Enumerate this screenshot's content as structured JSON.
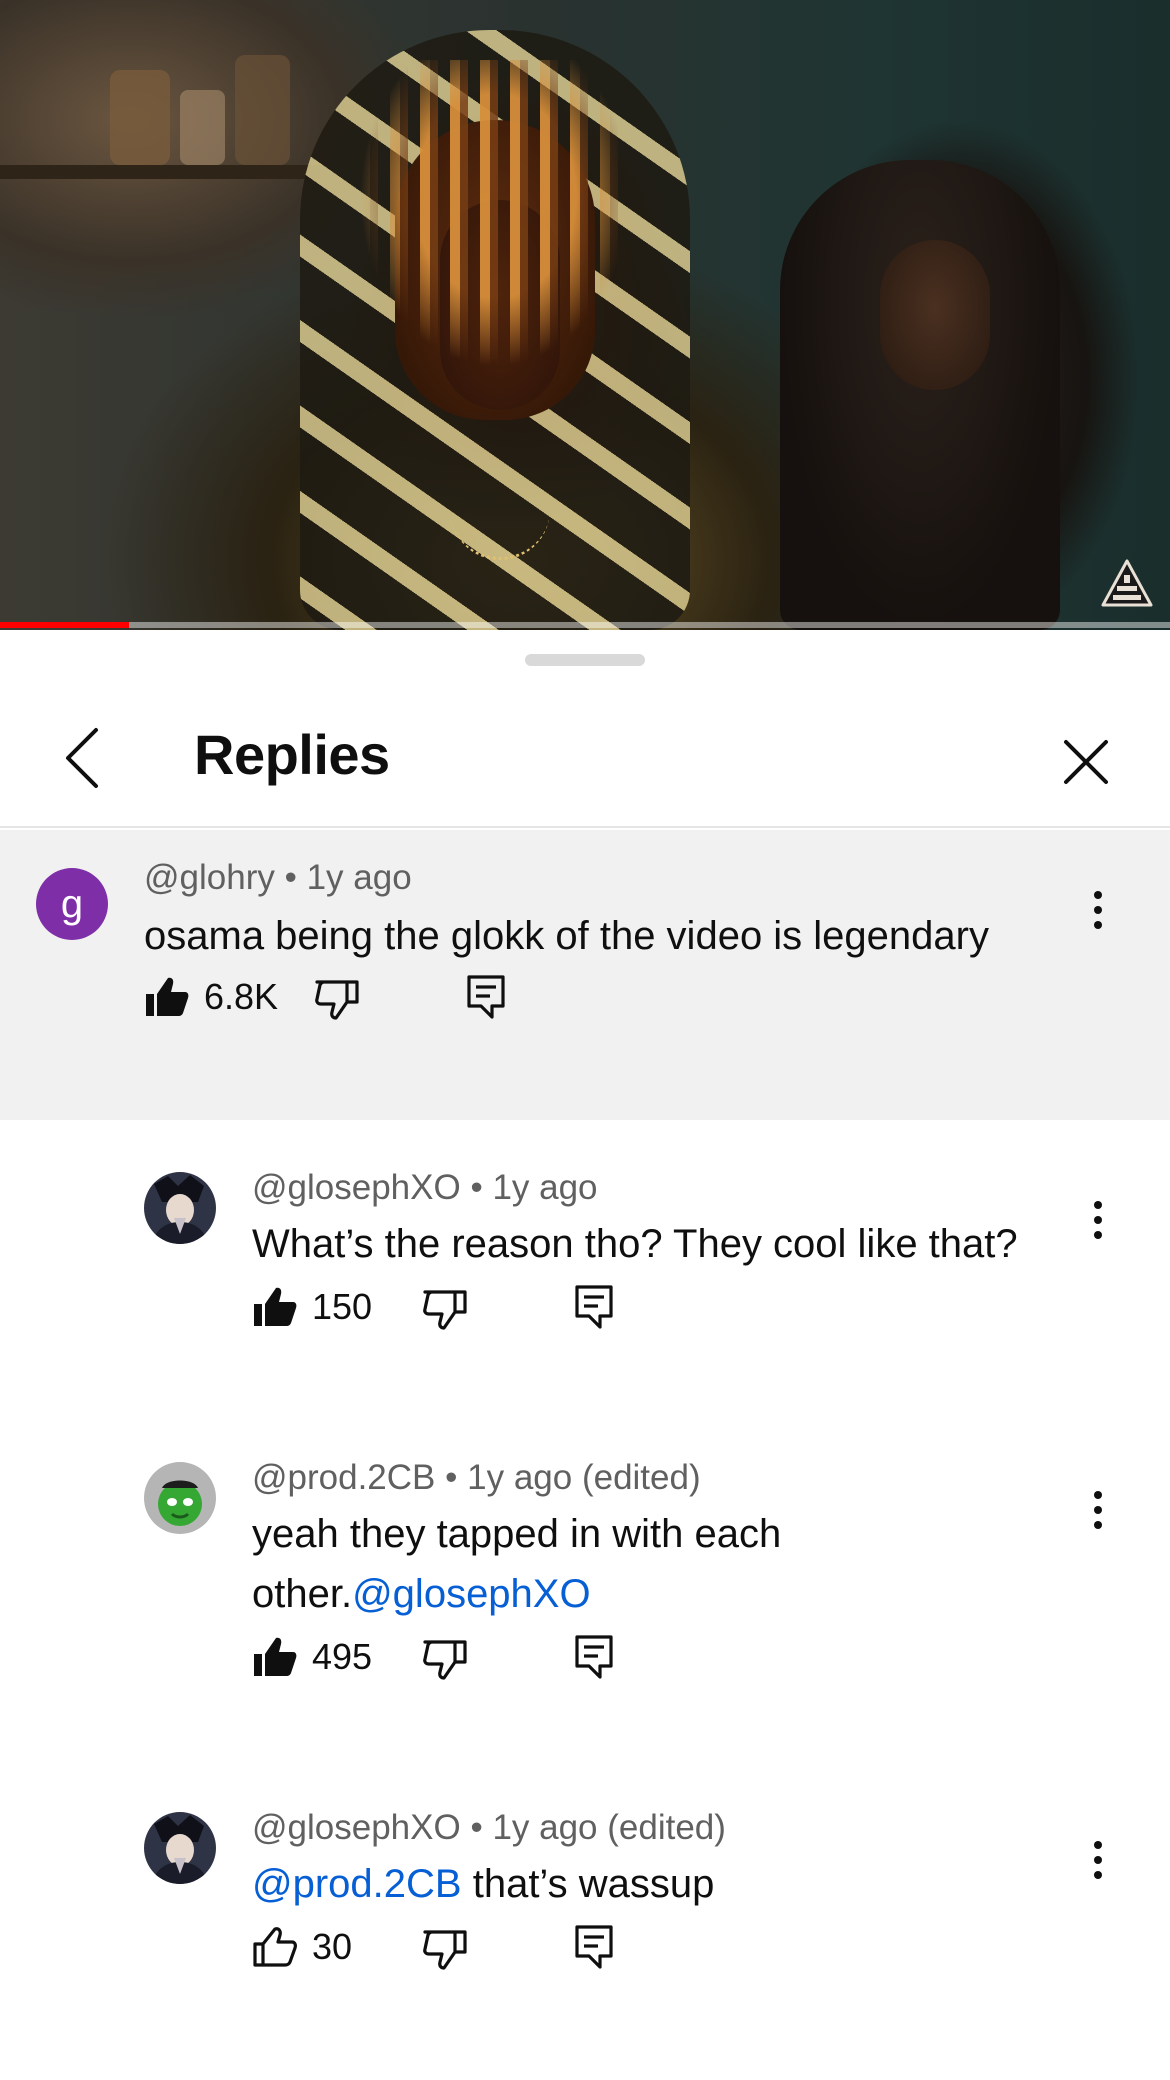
{
  "video": {
    "progress_fraction": 0.11
  },
  "sheet": {
    "title": "Replies"
  },
  "parent": {
    "avatar_letter": "g",
    "handle": "@glohry",
    "separator": "•",
    "time": "1y ago",
    "text": "osama being the glokk of the video is legendary",
    "likes": "6.8K"
  },
  "replies": [
    {
      "handle": "@glosephXO",
      "separator": "•",
      "time": "1y ago",
      "text": "What’s the reason tho? They cool like that?",
      "likes": "150"
    },
    {
      "handle": "@prod.2CB",
      "separator": "•",
      "time": "1y ago (edited)",
      "text_line1": "yeah they tapped in with each",
      "text_line2": "other.",
      "mention": "@glosephXO",
      "likes": "495"
    },
    {
      "handle": "@glosephXO",
      "separator": "•",
      "time": "1y ago (edited)",
      "mention": "@prod.2CB",
      "text": " that’s wassup",
      "likes": "30"
    }
  ],
  "colors": {
    "progress": "#ff0000",
    "mention": "#065fd4",
    "parent_bg": "#f1f1f1",
    "avatar_g": "#7e2fa8"
  }
}
